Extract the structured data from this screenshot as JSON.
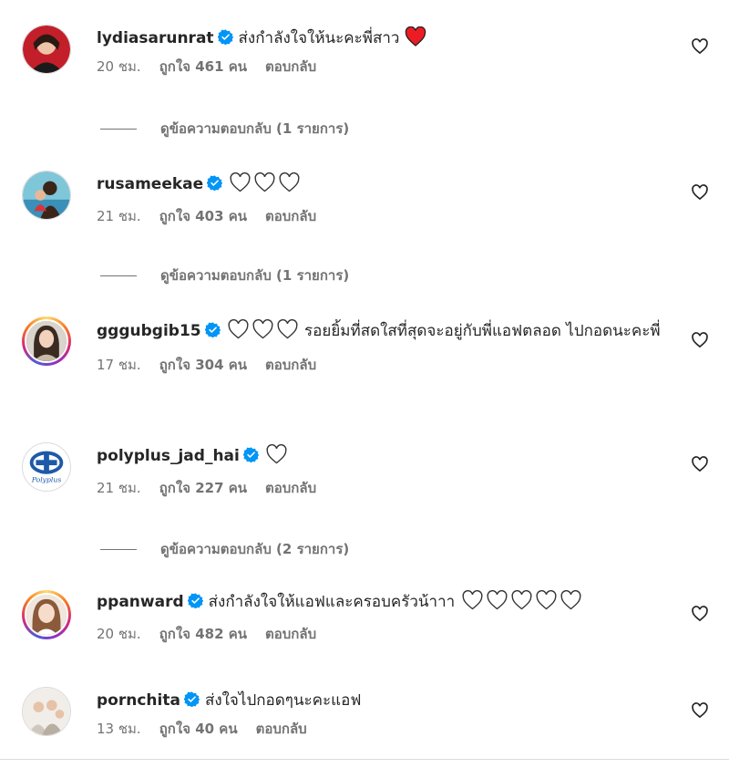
{
  "colors": {
    "verified": "#0095f6",
    "red_heart": "#ed1c24",
    "muted": "#737373"
  },
  "comments": [
    {
      "username": "lydiasarunrat",
      "text": "ส่งกำลังใจให้นะคะพี่สาว",
      "emoji": [
        "red-heart"
      ],
      "time": "20 ชม.",
      "likes": "ถูกใจ 461 คน",
      "reply": "ตอบกลับ",
      "view_replies": "ดูข้อความตอบกลับ (1 รายการ)"
    },
    {
      "username": "rusameekae",
      "text": "",
      "emoji": [
        "white-heart",
        "white-heart",
        "white-heart"
      ],
      "time": "21 ชม.",
      "likes": "ถูกใจ 403 คน",
      "reply": "ตอบกลับ",
      "view_replies": "ดูข้อความตอบกลับ (1 รายการ)"
    },
    {
      "username": "gggubgib15",
      "text": "รอยยิ้มที่สดใสที่สุดจะอยู่กับพี่แอฟตลอด ไปกอดนะคะพี่",
      "emoji": [
        "white-heart",
        "white-heart",
        "white-heart"
      ],
      "time": "17 ชม.",
      "likes": "ถูกใจ 304 คน",
      "reply": "ตอบกลับ"
    },
    {
      "username": "polyplus_jad_hai",
      "text": "",
      "emoji": [
        "white-heart"
      ],
      "time": "21 ชม.",
      "likes": "ถูกใจ 227 คน",
      "reply": "ตอบกลับ",
      "view_replies": "ดูข้อความตอบกลับ (2 รายการ)",
      "avatar_text": "Polyplus"
    },
    {
      "username": "ppanward",
      "text": "ส่งกำลังใจให้แอฟและครอบครัวน้าาา",
      "emoji": [
        "white-heart",
        "white-heart",
        "white-heart",
        "white-heart",
        "white-heart"
      ],
      "time": "20 ชม.",
      "likes": "ถูกใจ 482 คน",
      "reply": "ตอบกลับ"
    },
    {
      "username": "pornchita",
      "text": "ส่งใจไปกอดๆนะคะแอฟ",
      "emoji": [],
      "time": "13 ชม.",
      "likes": "ถูกใจ 40 คน",
      "reply": "ตอบกลับ"
    }
  ]
}
